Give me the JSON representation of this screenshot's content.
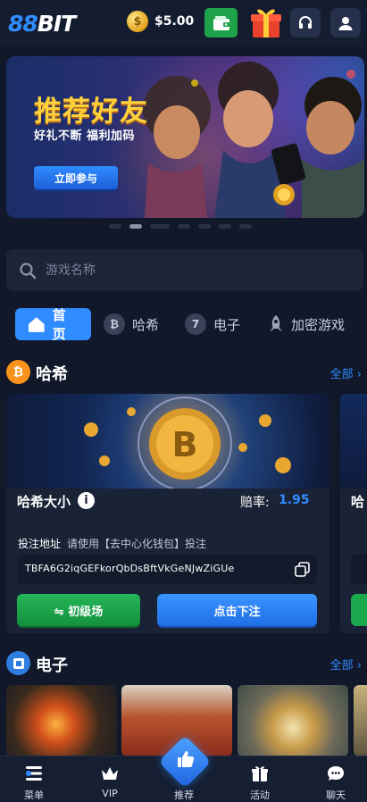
{
  "header": {
    "logo_main": "88",
    "logo_rest": "BIT",
    "balance": "$5.00",
    "icons": [
      "coin-icon",
      "wallet-icon",
      "gift-icon",
      "headset-icon",
      "user-icon"
    ]
  },
  "banner": {
    "title": "推荐好友",
    "subtitle": "好礼不断 福利加码",
    "cta": "立即参与"
  },
  "search": {
    "placeholder": "游戏名称"
  },
  "tabs": [
    {
      "label": "首页",
      "icon": "home-icon",
      "active": true
    },
    {
      "label": "哈希",
      "icon": "bitcoin-icon",
      "active": false
    },
    {
      "label": "电子",
      "icon": "seven-icon",
      "active": false
    },
    {
      "label": "加密游戏",
      "icon": "rocket-icon",
      "active": false
    }
  ],
  "hash_section": {
    "title": "哈希",
    "all_label": "全部 ›",
    "card": {
      "name": "哈希大小",
      "odds_label": "赔率:",
      "odds_value": "1.95",
      "bet_address_label": "投注地址",
      "bet_address_note": "请使用【去中心化钱包】投注",
      "address": "TBFA6G2iqGEFkorQbDsBftVkGeNJwZiGUe",
      "level_button": "⇋ 初级场",
      "bet_button": "点击下注"
    },
    "peek_card_name": "哈"
  },
  "slot_section": {
    "title": "电子",
    "all_label": "全部 ›"
  },
  "bottom_nav": [
    {
      "label": "菜单",
      "icon": "menu-icon"
    },
    {
      "label": "VIP",
      "icon": "crown-icon"
    },
    {
      "label": "推荐",
      "icon": "thumbs-up-icon"
    },
    {
      "label": "活动",
      "icon": "gift-icon"
    },
    {
      "label": "聊天",
      "icon": "chat-icon"
    }
  ],
  "colors": {
    "background": "#11182a",
    "accent_blue": "#2f8cff",
    "green": "#1fa34a",
    "banner_title": "#ffd23c"
  }
}
